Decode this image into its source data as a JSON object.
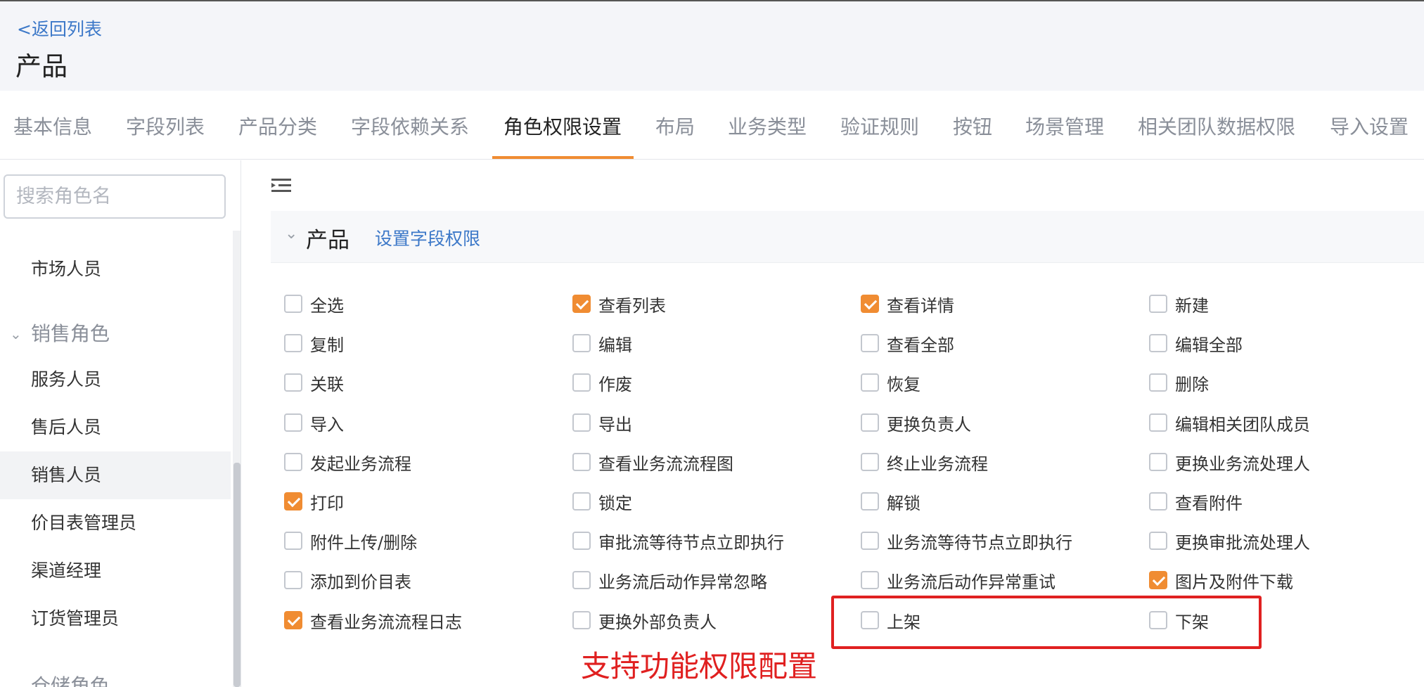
{
  "header": {
    "back_label": "<返回列表",
    "title": "产品"
  },
  "tabs": [
    {
      "label": "基本信息",
      "active": false
    },
    {
      "label": "字段列表",
      "active": false
    },
    {
      "label": "产品分类",
      "active": false
    },
    {
      "label": "字段依赖关系",
      "active": false
    },
    {
      "label": "角色权限设置",
      "active": true
    },
    {
      "label": "布局",
      "active": false
    },
    {
      "label": "业务类型",
      "active": false
    },
    {
      "label": "验证规则",
      "active": false
    },
    {
      "label": "按钮",
      "active": false
    },
    {
      "label": "场景管理",
      "active": false
    },
    {
      "label": "相关团队数据权限",
      "active": false
    },
    {
      "label": "导入设置",
      "active": false
    }
  ],
  "sidebar": {
    "search_placeholder": "搜索角色名",
    "items": [
      {
        "label": "市场人员"
      },
      {
        "label": "销售角色"
      },
      {
        "label": "服务人员"
      },
      {
        "label": "售后人员"
      },
      {
        "label": "销售人员"
      },
      {
        "label": "价目表管理员"
      },
      {
        "label": "渠道经理"
      },
      {
        "label": "订货管理员"
      },
      {
        "label": "仓储角色"
      }
    ]
  },
  "section": {
    "title": "产品",
    "link": "设置字段权限"
  },
  "permissions": [
    {
      "label": "全选",
      "checked": false
    },
    {
      "label": "查看列表",
      "checked": true
    },
    {
      "label": "查看详情",
      "checked": true
    },
    {
      "label": "新建",
      "checked": false
    },
    {
      "label": "复制",
      "checked": false
    },
    {
      "label": "编辑",
      "checked": false
    },
    {
      "label": "查看全部",
      "checked": false
    },
    {
      "label": "编辑全部",
      "checked": false
    },
    {
      "label": "关联",
      "checked": false
    },
    {
      "label": "作废",
      "checked": false
    },
    {
      "label": "恢复",
      "checked": false
    },
    {
      "label": "删除",
      "checked": false
    },
    {
      "label": "导入",
      "checked": false
    },
    {
      "label": "导出",
      "checked": false
    },
    {
      "label": "更换负责人",
      "checked": false
    },
    {
      "label": "编辑相关团队成员",
      "checked": false
    },
    {
      "label": "发起业务流程",
      "checked": false
    },
    {
      "label": "查看业务流流程图",
      "checked": false
    },
    {
      "label": "终止业务流程",
      "checked": false
    },
    {
      "label": "更换业务流处理人",
      "checked": false
    },
    {
      "label": "打印",
      "checked": true
    },
    {
      "label": "锁定",
      "checked": false
    },
    {
      "label": "解锁",
      "checked": false
    },
    {
      "label": "查看附件",
      "checked": false
    },
    {
      "label": "附件上传/删除",
      "checked": false
    },
    {
      "label": "审批流等待节点立即执行",
      "checked": false
    },
    {
      "label": "业务流等待节点立即执行",
      "checked": false
    },
    {
      "label": "更换审批流处理人",
      "checked": false
    },
    {
      "label": "添加到价目表",
      "checked": false
    },
    {
      "label": "业务流后动作异常忽略",
      "checked": false
    },
    {
      "label": "业务流后动作异常重试",
      "checked": false
    },
    {
      "label": "图片及附件下载",
      "checked": true
    },
    {
      "label": "查看业务流流程日志",
      "checked": true
    },
    {
      "label": "更换外部负责人",
      "checked": false
    },
    {
      "label": "上架",
      "checked": false
    },
    {
      "label": "下架",
      "checked": false
    }
  ],
  "annotation": {
    "text": "支持功能权限配置",
    "color": "#e02020"
  },
  "colors": {
    "accent": "#f08c32",
    "link": "#3c78c8",
    "highlight": "#e02020"
  }
}
